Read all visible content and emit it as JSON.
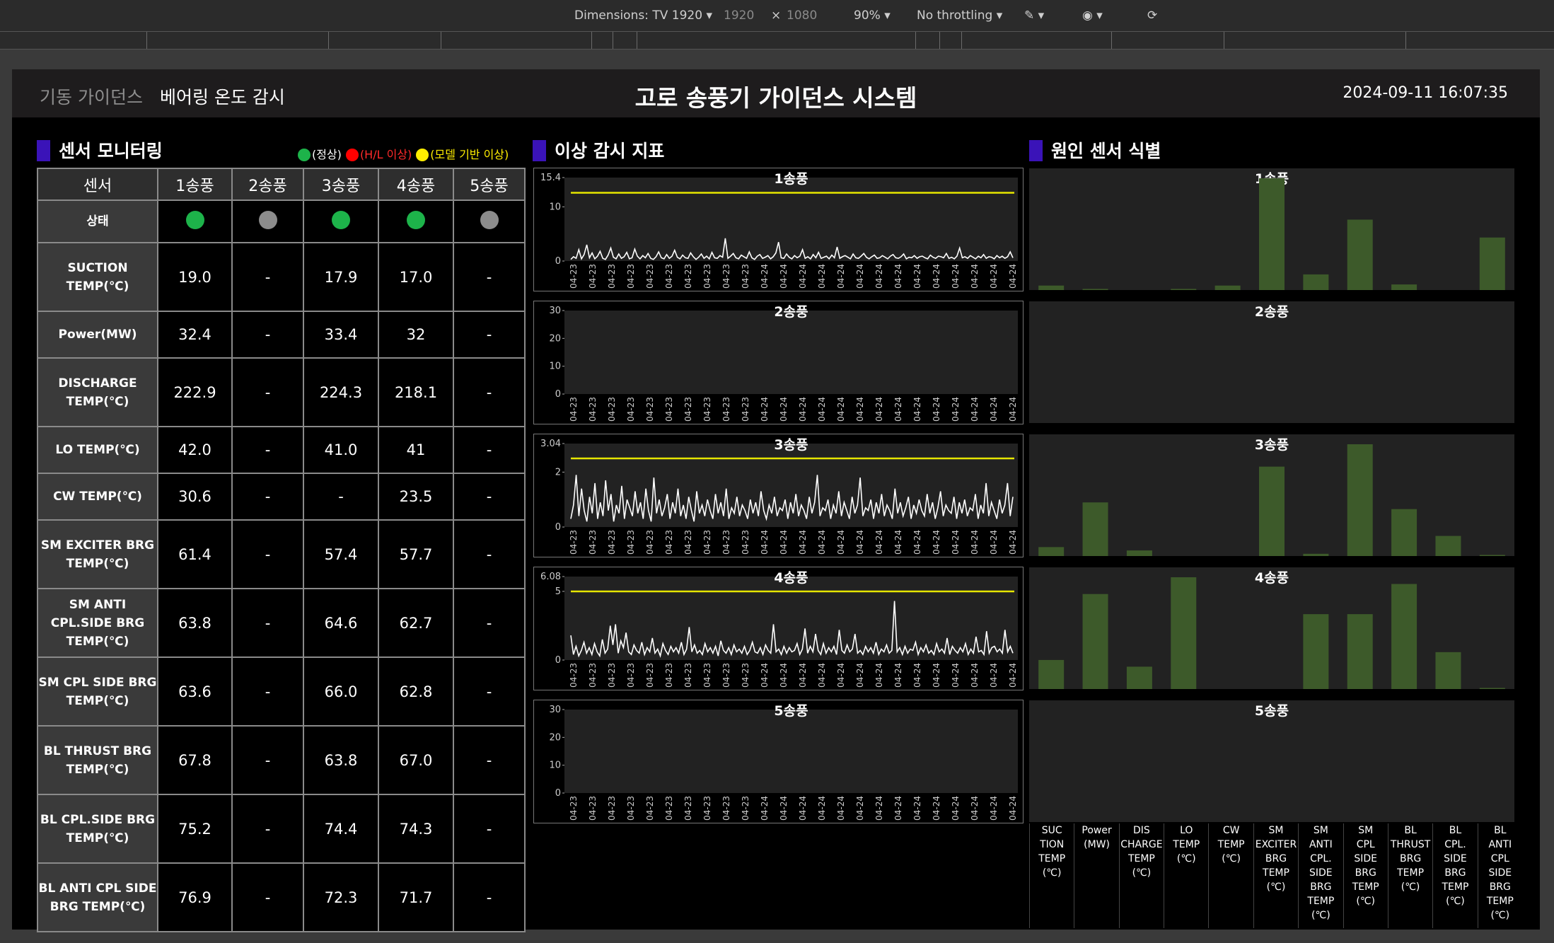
{
  "devtools": {
    "dimensions": "Dimensions: TV 1920",
    "width": "1920",
    "times": "×",
    "height": "1080",
    "zoom": "90%",
    "throttling": "No throttling"
  },
  "header": {
    "nav_guidance": "기동 가이던스",
    "nav_bearing": "베어링 온도 감시",
    "title": "고로 송풍기 가이던스 시스템",
    "datetime": "2024-09-11 16:07:35"
  },
  "sections": {
    "sensor": "센서 모니터링",
    "anomaly": "이상 감시 지표",
    "cause": "원인 센서 식별"
  },
  "legend": [
    {
      "label": "(정상)",
      "color": "#1db34a",
      "text_color": "#ffffff"
    },
    {
      "label": "(H/L 이상)",
      "color": "#ff0000",
      "text_color": "#ff2a2a"
    },
    {
      "label": "(모델 기반 이상)",
      "color": "#ffee00",
      "text_color": "#ffee00"
    }
  ],
  "table": {
    "header": [
      "센서",
      "1송풍",
      "2송풍",
      "3송풍",
      "4송풍",
      "5송풍"
    ],
    "status_label": "상태",
    "status": [
      "green",
      "gray",
      "green",
      "green",
      "gray"
    ],
    "rows": [
      {
        "sensor": "SUCTION TEMP(℃)",
        "values": [
          "19.0",
          "-",
          "17.9",
          "17.0",
          "-"
        ]
      },
      {
        "sensor": "Power(MW)",
        "values": [
          "32.4",
          "-",
          "33.4",
          "32",
          "-"
        ]
      },
      {
        "sensor": "DISCHARGE TEMP(℃)",
        "values": [
          "222.9",
          "-",
          "224.3",
          "218.1",
          "-"
        ]
      },
      {
        "sensor": "LO TEMP(℃)",
        "values": [
          "42.0",
          "-",
          "41.0",
          "41",
          "-"
        ]
      },
      {
        "sensor": "CW TEMP(℃)",
        "values": [
          "30.6",
          "-",
          "-",
          "23.5",
          "-"
        ]
      },
      {
        "sensor": "SM EXCITER BRG TEMP(℃)",
        "values": [
          "61.4",
          "-",
          "57.4",
          "57.7",
          "-"
        ]
      },
      {
        "sensor": "SM ANTI CPL.SIDE BRG TEMP(℃)",
        "values": [
          "63.8",
          "-",
          "64.6",
          "62.7",
          "-"
        ]
      },
      {
        "sensor": "SM CPL SIDE BRG TEMP(℃)",
        "values": [
          "63.6",
          "-",
          "66.0",
          "62.8",
          "-"
        ]
      },
      {
        "sensor": "BL THRUST BRG TEMP(℃)",
        "values": [
          "67.8",
          "-",
          "63.8",
          "67.0",
          "-"
        ]
      },
      {
        "sensor": "BL CPL.SIDE BRG TEMP(℃)",
        "values": [
          "75.2",
          "-",
          "74.4",
          "74.3",
          "-"
        ]
      },
      {
        "sensor": "BL ANTI CPL SIDE BRG TEMP(℃)",
        "values": [
          "76.9",
          "-",
          "72.3",
          "71.7",
          "-"
        ]
      }
    ]
  },
  "colors": {
    "status_green": "#1db34a",
    "status_gray": "#8c8c8c",
    "threshold": "#e6e600",
    "bar": "#3d5a2a",
    "section_marker": "#3a13b8"
  },
  "chart_data": [
    {
      "type": "line",
      "title": "1송풍",
      "ylim": [
        0,
        15.4
      ],
      "yticks": [
        "0",
        "10",
        "15.4"
      ],
      "xticks": [
        "04-23",
        "04-23",
        "04-23",
        "04-23",
        "04-23",
        "04-23",
        "04-23",
        "04-23",
        "04-23",
        "04-23",
        "04-24",
        "04-24",
        "04-24",
        "04-24",
        "04-24",
        "04-24",
        "04-24",
        "04-24",
        "04-24",
        "04-24",
        "04-24",
        "04-24",
        "04-24",
        "04-24"
      ],
      "threshold": 12.6,
      "series": [
        {
          "values": [
            0.3,
            0.8,
            0.5,
            2.1,
            0.4,
            1.2,
            3.0,
            0.6,
            1.5,
            0.4,
            0.9,
            1.8,
            0.5,
            0.3,
            1.1,
            2.4,
            0.7,
            0.4,
            1.3,
            0.5,
            0.8,
            1.6,
            0.4,
            0.6,
            2.2,
            0.9,
            0.4,
            1.0,
            0.6,
            1.4,
            0.5,
            0.3,
            0.8,
            1.7,
            0.6,
            0.4,
            1.2,
            0.5,
            0.9,
            2.0,
            0.7,
            0.4,
            1.1,
            0.6,
            0.5,
            1.5,
            0.8,
            0.3,
            0.7,
            1.3,
            0.5,
            0.9,
            0.4,
            1.6,
            0.6,
            0.5,
            1.0,
            0.7,
            4.2,
            0.5,
            0.9,
            1.4,
            0.6,
            0.4,
            1.1,
            0.8,
            0.5,
            1.7,
            0.6,
            0.3,
            0.9,
            1.2,
            0.5,
            0.7,
            1.0,
            0.4,
            0.8,
            1.5,
            3.5,
            0.6,
            0.5,
            1.3,
            0.7,
            0.4,
            1.0,
            0.6,
            0.9,
            2.1,
            0.5,
            0.8,
            0.4,
            1.2,
            0.6,
            1.6,
            0.5,
            0.7,
            0.9,
            0.4,
            1.1,
            0.6,
            2.6,
            0.5,
            0.8,
            1.0,
            0.7,
            0.4,
            1.3,
            0.6,
            0.5,
            0.9,
            1.4,
            0.7,
            0.4,
            0.8,
            1.1,
            0.5,
            0.6,
            1.0,
            0.7,
            0.4,
            0.9,
            1.2,
            0.6,
            0.5,
            0.8,
            1.3,
            0.4,
            0.7,
            0.6,
            1.0,
            0.5,
            0.8,
            0.9,
            0.6,
            0.4,
            1.1,
            0.7,
            0.5,
            0.9,
            0.8,
            0.6,
            1.4,
            0.5,
            0.7,
            0.4,
            0.9,
            2.4,
            0.6,
            0.8,
            0.5,
            1.0,
            0.7,
            0.4,
            0.9,
            0.6,
            1.2,
            0.5,
            0.8,
            0.7,
            0.4,
            1.0,
            0.6,
            0.9,
            0.5,
            0.8,
            1.7,
            0.6
          ]
        }
      ]
    },
    {
      "type": "line",
      "title": "2송풍",
      "ylim": [
        0,
        30
      ],
      "yticks": [
        "0",
        "10",
        "20",
        "30"
      ],
      "xticks": [
        "04-23",
        "04-23",
        "04-23",
        "04-23",
        "04-23",
        "04-23",
        "04-23",
        "04-23",
        "04-23",
        "04-23",
        "04-24",
        "04-24",
        "04-24",
        "04-24",
        "04-24",
        "04-24",
        "04-24",
        "04-24",
        "04-24",
        "04-24",
        "04-24",
        "04-24",
        "04-24",
        "04-24"
      ],
      "series": []
    },
    {
      "type": "line",
      "title": "3송풍",
      "ylim": [
        0,
        3.04
      ],
      "yticks": [
        "0",
        "2",
        "3.04"
      ],
      "xticks": [
        "04-23",
        "04-23",
        "04-23",
        "04-23",
        "04-23",
        "04-23",
        "04-23",
        "04-23",
        "04-23",
        "04-23",
        "04-24",
        "04-24",
        "04-24",
        "04-24",
        "04-24",
        "04-24",
        "04-24",
        "04-24",
        "04-24",
        "04-24",
        "04-24",
        "04-24",
        "04-24",
        "04-24"
      ],
      "threshold": 2.5,
      "series": [
        {
          "values": [
            0.3,
            0.8,
            1.9,
            0.4,
            1.4,
            0.6,
            0.2,
            1.1,
            0.5,
            1.6,
            0.3,
            0.9,
            0.4,
            1.7,
            0.6,
            1.2,
            0.2,
            0.8,
            0.5,
            1.5,
            0.3,
            1.0,
            0.7,
            0.4,
            1.3,
            0.5,
            0.9,
            0.3,
            1.4,
            0.6,
            0.2,
            1.8,
            0.5,
            1.0,
            0.4,
            0.7,
            1.2,
            0.3,
            0.9,
            0.5,
            1.4,
            0.4,
            0.8,
            0.3,
            1.1,
            0.6,
            0.2,
            1.3,
            0.5,
            0.8,
            0.4,
            1.0,
            0.6,
            0.3,
            1.2,
            0.5,
            0.9,
            0.4,
            1.4,
            0.3,
            0.7,
            0.5,
            1.1,
            0.4,
            0.8,
            0.6,
            0.3,
            1.0,
            0.5,
            0.9,
            0.4,
            1.3,
            0.6,
            0.3,
            0.8,
            0.5,
            1.1,
            0.4,
            0.7,
            0.6,
            1.0,
            0.3,
            0.9,
            0.5,
            1.2,
            0.4,
            0.8,
            0.6,
            0.3,
            1.1,
            0.5,
            0.9,
            1.9,
            0.4,
            0.7,
            0.6,
            1.0,
            0.3,
            0.8,
            0.5,
            1.3,
            0.4,
            0.9,
            0.6,
            0.3,
            1.1,
            0.5,
            0.8,
            1.8,
            0.4,
            0.7,
            0.6,
            1.0,
            0.3,
            0.9,
            0.5,
            1.2,
            0.4,
            0.8,
            0.6,
            0.3,
            1.4,
            0.5,
            0.9,
            0.4,
            0.7,
            1.1,
            0.3,
            0.8,
            0.5,
            1.0,
            0.6,
            0.4,
            1.2,
            0.5,
            0.9,
            0.3,
            0.7,
            1.3,
            0.4,
            0.8,
            0.6,
            0.5,
            1.1,
            0.3,
            0.9,
            0.5,
            1.0,
            0.4,
            0.7,
            0.6,
            1.2,
            0.3,
            0.8,
            0.5,
            1.6,
            0.4,
            0.9,
            0.6,
            0.3,
            1.0,
            0.5,
            0.8,
            1.6,
            0.4,
            1.1
          ]
        }
      ]
    },
    {
      "type": "line",
      "title": "4송풍",
      "ylim": [
        0,
        6.08
      ],
      "yticks": [
        "0",
        "5",
        "6.08"
      ],
      "xticks": [
        "04-23",
        "04-23",
        "04-23",
        "04-23",
        "04-23",
        "04-23",
        "04-23",
        "04-23",
        "04-23",
        "04-23",
        "04-24",
        "04-24",
        "04-24",
        "04-24",
        "04-24",
        "04-24",
        "04-24",
        "04-24",
        "04-24",
        "04-24",
        "04-24",
        "04-24",
        "04-24",
        "04-24"
      ],
      "threshold": 5.0,
      "series": [
        {
          "values": [
            1.8,
            0.4,
            1.0,
            0.3,
            0.7,
            1.3,
            0.5,
            0.9,
            0.4,
            1.2,
            0.6,
            0.3,
            1.5,
            0.5,
            0.8,
            2.5,
            1.1,
            2.6,
            0.5,
            1.4,
            0.9,
            2.0,
            0.6,
            0.4,
            1.1,
            0.7,
            0.5,
            1.3,
            0.4,
            0.9,
            0.6,
            1.6,
            0.5,
            0.8,
            0.3,
            1.2,
            0.7,
            0.4,
            1.0,
            0.6,
            0.9,
            0.5,
            1.3,
            0.4,
            0.8,
            2.4,
            0.6,
            1.1,
            0.5,
            0.7,
            0.4,
            1.2,
            0.6,
            0.9,
            0.5,
            1.0,
            0.3,
            1.4,
            0.7,
            0.5,
            0.9,
            0.4,
            1.1,
            0.6,
            0.8,
            0.5,
            1.0,
            0.4,
            0.7,
            1.3,
            0.6,
            0.5,
            0.9,
            0.4,
            1.1,
            0.7,
            0.5,
            2.6,
            0.6,
            0.8,
            0.4,
            1.0,
            0.5,
            0.9,
            0.6,
            0.7,
            1.2,
            0.4,
            0.8,
            2.3,
            0.5,
            1.0,
            0.6,
            1.9,
            0.7,
            0.4,
            1.2,
            0.5,
            0.9,
            0.6,
            1.0,
            0.4,
            2.2,
            0.7,
            0.5,
            1.1,
            0.6,
            0.8,
            1.9,
            0.5,
            0.7,
            0.4,
            1.0,
            0.6,
            0.9,
            0.5,
            1.3,
            0.4,
            0.8,
            0.6,
            1.1,
            0.5,
            0.7,
            4.3,
            0.6,
            0.9,
            0.4,
            1.0,
            0.5,
            0.8,
            0.7,
            1.3,
            0.4,
            0.9,
            0.6,
            1.1,
            0.5,
            0.7,
            0.4,
            1.2,
            0.6,
            0.8,
            0.5,
            1.6,
            0.4,
            1.0,
            0.7,
            0.5,
            0.9,
            0.6,
            1.2,
            0.4,
            0.8,
            0.5,
            1.7,
            0.6,
            0.7,
            0.4,
            2.1,
            0.5,
            0.9,
            1.0,
            0.6,
            0.8,
            0.5,
            2.2,
            0.6,
            1.0,
            0.5
          ]
        }
      ]
    },
    {
      "type": "line",
      "title": "5송풍",
      "ylim": [
        0,
        30
      ],
      "yticks": [
        "0",
        "10",
        "20",
        "30"
      ],
      "xticks": [
        "04-23",
        "04-23",
        "04-23",
        "04-23",
        "04-23",
        "04-23",
        "04-23",
        "04-23",
        "04-23",
        "04-23",
        "04-24",
        "04-24",
        "04-24",
        "04-24",
        "04-24",
        "04-24",
        "04-24",
        "04-24",
        "04-24",
        "04-24",
        "04-24",
        "04-24",
        "04-24",
        "04-24"
      ],
      "series": []
    },
    {
      "type": "bar",
      "title": "1송풍",
      "categories": [
        "SUC TION TEMP (℃)",
        "Power (MW)",
        "DIS CHARGE TEMP (℃)",
        "LO TEMP (℃)",
        "CW TEMP (℃)",
        "SM EXCITER BRG TEMP (℃)",
        "SM ANTI CPL. SIDE BRG TEMP (℃)",
        "SM CPL SIDE BRG TEMP (℃)",
        "BL THRUST BRG TEMP (℃)",
        "BL CPL. SIDE BRG TEMP (℃)",
        "BL ANTI CPL SIDE BRG TEMP (℃)"
      ],
      "values": [
        0.04,
        0.01,
        0.0,
        0.01,
        0.04,
        1.0,
        0.14,
        0.63,
        0.05,
        0.0,
        0.47
      ],
      "ylim": [
        0,
        1
      ]
    },
    {
      "type": "bar",
      "title": "2송풍",
      "categories": [
        "SUC TION TEMP (℃)",
        "Power (MW)",
        "DIS CHARGE TEMP (℃)",
        "LO TEMP (℃)",
        "CW TEMP (℃)",
        "SM EXCITER BRG TEMP (℃)",
        "SM ANTI CPL. SIDE BRG TEMP (℃)",
        "SM CPL SIDE BRG TEMP (℃)",
        "BL THRUST BRG TEMP (℃)",
        "BL CPL. SIDE BRG TEMP (℃)",
        "BL ANTI CPL SIDE BRG TEMP (℃)"
      ],
      "values": [],
      "ylim": [
        0,
        1
      ]
    },
    {
      "type": "bar",
      "title": "3송풍",
      "categories": [
        "SUC TION TEMP (℃)",
        "Power (MW)",
        "DIS CHARGE TEMP (℃)",
        "LO TEMP (℃)",
        "CW TEMP (℃)",
        "SM EXCITER BRG TEMP (℃)",
        "SM ANTI CPL. SIDE BRG TEMP (℃)",
        "SM CPL SIDE BRG TEMP (℃)",
        "BL THRUST BRG TEMP (℃)",
        "BL CPL. SIDE BRG TEMP (℃)",
        "BL ANTI CPL SIDE BRG TEMP (℃)"
      ],
      "values": [
        0.08,
        0.48,
        0.05,
        0.0,
        0.0,
        0.8,
        0.02,
        1.0,
        0.42,
        0.18,
        0.01
      ],
      "ylim": [
        0,
        1
      ]
    },
    {
      "type": "bar",
      "title": "4송풍",
      "categories": [
        "SUC TION TEMP (℃)",
        "Power (MW)",
        "DIS CHARGE TEMP (℃)",
        "LO TEMP (℃)",
        "CW TEMP (℃)",
        "SM EXCITER BRG TEMP (℃)",
        "SM ANTI CPL. SIDE BRG TEMP (℃)",
        "SM CPL SIDE BRG TEMP (℃)",
        "BL THRUST BRG TEMP (℃)",
        "BL CPL. SIDE BRG TEMP (℃)",
        "BL ANTI CPL SIDE BRG TEMP (℃)"
      ],
      "values": [
        0.26,
        0.85,
        0.2,
        1.0,
        0.0,
        0.0,
        0.67,
        0.67,
        0.94,
        0.33,
        0.01
      ],
      "ylim": [
        0,
        1
      ]
    },
    {
      "type": "bar",
      "title": "5송풍",
      "categories": [
        "SUC TION TEMP (℃)",
        "Power (MW)",
        "DIS CHARGE TEMP (℃)",
        "LO TEMP (℃)",
        "CW TEMP (℃)",
        "SM EXCITER BRG TEMP (℃)",
        "SM ANTI CPL. SIDE BRG TEMP (℃)",
        "SM CPL SIDE BRG TEMP (℃)",
        "BL THRUST BRG TEMP (℃)",
        "BL CPL. SIDE BRG TEMP (℃)",
        "BL ANTI CPL SIDE BRG TEMP (℃)"
      ],
      "values": [],
      "ylim": [
        0,
        1
      ]
    }
  ]
}
